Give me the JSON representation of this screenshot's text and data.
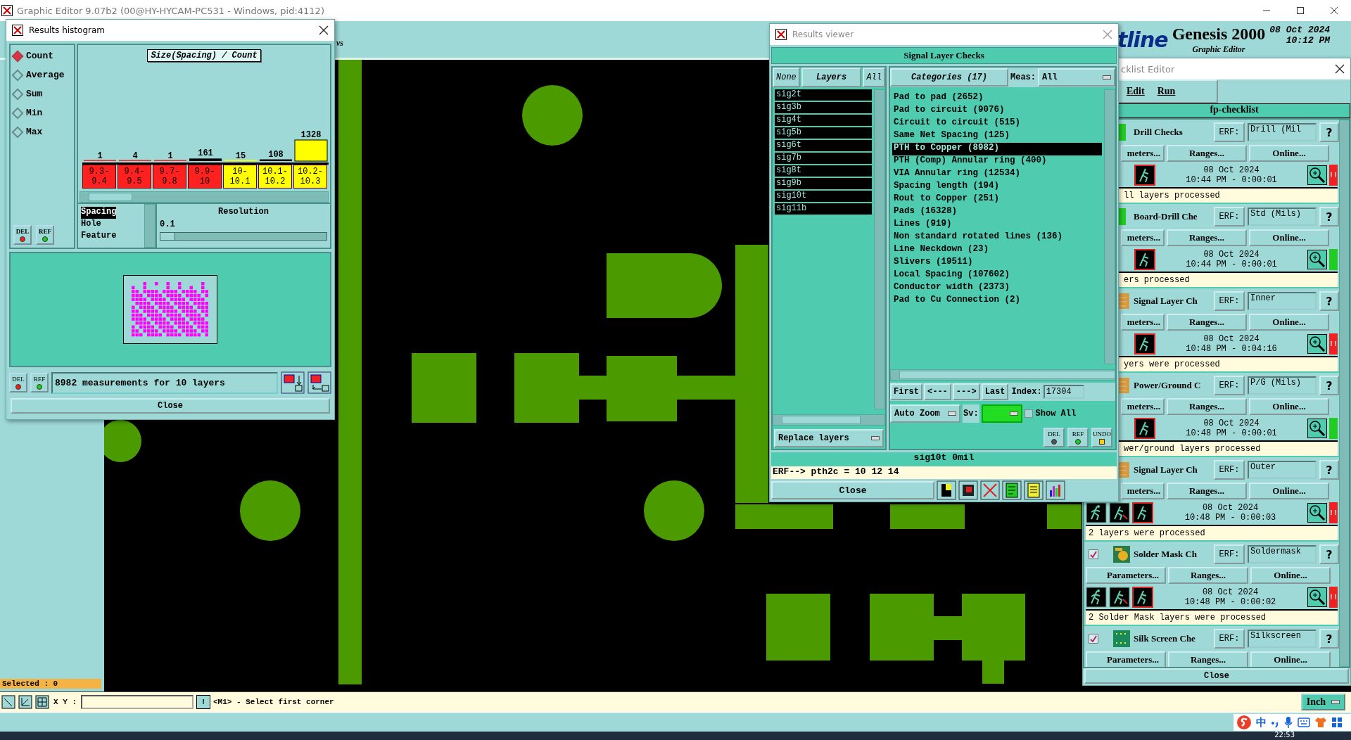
{
  "app": {
    "title": "Graphic Editor 9.07b2 (00@HY-HYCAM-PC531 - Windows, pid:4112)",
    "toolbar_fragment": "vs"
  },
  "banner": {
    "logo": "tline",
    "product": "Genesis 2000",
    "date": "08 Oct 2024",
    "time": "10:12 PM",
    "subtitle": "Graphic Editor"
  },
  "histogram": {
    "title": "Results histogram",
    "modes": [
      {
        "label": "Count",
        "selected": true
      },
      {
        "label": "Average",
        "selected": false
      },
      {
        "label": "Sum",
        "selected": false
      },
      {
        "label": "Min",
        "selected": false
      },
      {
        "label": "Max",
        "selected": false
      }
    ],
    "top_buttons": [
      "DEL",
      "REF"
    ],
    "chart_title": "Size(Spacing) / Count",
    "chart_data": {
      "type": "bar",
      "categories": [
        "9.3-9.4",
        "9.4-9.5",
        "9.7-9.8",
        "9.9-10",
        "10-10.1",
        "10.1-10.2",
        "10.2-10.3"
      ],
      "values": [
        1,
        4,
        1,
        161,
        15,
        108,
        1328
      ],
      "data_labels": true
    },
    "bins": [
      {
        "color": "#ff2020"
      },
      {
        "color": "#ff2020"
      },
      {
        "color": "#ff2020"
      },
      {
        "color": "#ff2020"
      },
      {
        "color": "#ffff00"
      },
      {
        "color": "#ffff00"
      },
      {
        "color": "#ffff00"
      }
    ],
    "measures": [
      {
        "label": "Spacing",
        "selected": true
      },
      {
        "label": "Hole",
        "selected": false
      },
      {
        "label": "Feature",
        "selected": false
      }
    ],
    "resolution_label": "Resolution",
    "resolution_value": "0.1",
    "resolution_slider": {
      "level": 0.08
    },
    "bottom_buttons": [
      "DEL",
      "REF"
    ],
    "summary": "8982 measurements for 10 layers",
    "close": "Close"
  },
  "viewer": {
    "title": "Results viewer",
    "header": "Signal Layer Checks",
    "layer_buttons": [
      "None",
      "Layers",
      "All"
    ],
    "layers": [
      {
        "name": "sig2t",
        "selected": true
      },
      {
        "name": "sig3b",
        "selected": true
      },
      {
        "name": "sig4t",
        "selected": true
      },
      {
        "name": "sig5b",
        "selected": true
      },
      {
        "name": "sig6t",
        "selected": true
      },
      {
        "name": "sig7b",
        "selected": true
      },
      {
        "name": "sig8t",
        "selected": true
      },
      {
        "name": "sig9b",
        "selected": true
      },
      {
        "name": "sig10t",
        "selected": true
      },
      {
        "name": "sig11b",
        "selected": true
      }
    ],
    "categories_button": "Categories (17)",
    "meas_label": "Meas:",
    "meas_value": "All",
    "categories": [
      {
        "label": "Pad to pad (2652)",
        "selected": false
      },
      {
        "label": "Pad to circuit (9076)",
        "selected": false
      },
      {
        "label": "Circuit to circuit (515)",
        "selected": false
      },
      {
        "label": "Same Net Spacing (125)",
        "selected": false
      },
      {
        "label": "PTH to Copper (8982)",
        "selected": true
      },
      {
        "label": "PTH (Comp) Annular ring (400)",
        "selected": false
      },
      {
        "label": "VIA Annular ring (12534)",
        "selected": false
      },
      {
        "label": "Spacing length (194)",
        "selected": false
      },
      {
        "label": "Rout to Copper (251)",
        "selected": false
      },
      {
        "label": "Pads (16328)",
        "selected": false
      },
      {
        "label": "Lines (919)",
        "selected": false
      },
      {
        "label": "Non standard rotated lines (136)",
        "selected": false
      },
      {
        "label": "Line Neckdown (23)",
        "selected": false
      },
      {
        "label": "Slivers (19511)",
        "selected": false
      },
      {
        "label": "Local Spacing (107602)",
        "selected": false
      },
      {
        "label": "Conductor width (2373)",
        "selected": false
      },
      {
        "label": "Pad to Cu Connection (2)",
        "selected": false
      }
    ],
    "nav": [
      "First",
      "<---",
      "--->",
      "Last"
    ],
    "index_label": "Index:",
    "index_value": "17304",
    "zoom_mode": "Auto Zoom",
    "sv_label": "Sv:",
    "show_all": {
      "label": "Show All",
      "checked": false
    },
    "replace_mode": "Replace layers",
    "action_buttons": [
      "DEL",
      "REF",
      "UNDO"
    ],
    "layer_info": "sig10t 0mil",
    "erf_line": "ERF--> pth2c = 10 12 14",
    "close": "Close"
  },
  "checklist": {
    "title": "cklist Editor",
    "menu": [
      "Edit",
      "Run"
    ],
    "name": "fp-checklist",
    "rows": [
      {
        "kind": "drill",
        "name": "Drill Checks",
        "erf_label": "ERF:",
        "erf": "Drill (Mil",
        "help": "?",
        "params": "meters...",
        "ranges": "Ranges...",
        "online": "Online...",
        "date": "08 Oct 2024",
        "time": "10:44 PM - 0:00:01",
        "failed": true,
        "flag": "!!",
        "status": "ll layers processed"
      },
      {
        "kind": "drill",
        "name": "Board-Drill Che",
        "erf_label": "ERF:",
        "erf": "Std (Mils)",
        "help": "?",
        "params": "meters...",
        "ranges": "Ranges...",
        "online": "Online...",
        "date": "08 Oct 2024",
        "time": "10:44 PM - 0:00:01",
        "failed": false,
        "status": "ers processed"
      },
      {
        "kind": "layer",
        "name": "Signal Layer Ch",
        "erf_label": "ERF:",
        "erf": "Inner",
        "help": "?",
        "params": "meters...",
        "ranges": "Ranges...",
        "online": "Online...",
        "date": "08 Oct 2024",
        "time": "10:48 PM - 0:04:16",
        "failed": true,
        "flag": "!!",
        "status": "yers were processed"
      },
      {
        "kind": "layer",
        "name": "Power/Ground C",
        "erf_label": "ERF:",
        "erf": "P/G (Mils)",
        "help": "?",
        "params": "meters...",
        "ranges": "Ranges...",
        "online": "Online...",
        "date": "08 Oct 2024",
        "time": "10:48 PM - 0:00:01",
        "failed": false,
        "status": "wer/ground layers processed"
      },
      {
        "kind": "layer",
        "name": "Signal Layer Ch",
        "erf_label": "ERF:",
        "erf": "Outer",
        "help": "?",
        "params": "meters...",
        "ranges": "Ranges...",
        "online": "Online...",
        "date": "08 Oct 2024",
        "time": "10:48 PM - 0:00:03",
        "failed": true,
        "flag": "!!",
        "status": "2 layers were processed"
      },
      {
        "kind": "mask",
        "checked": true,
        "name": "Solder Mask Ch",
        "erf_label": "ERF:",
        "erf": "Soldermask",
        "help": "?",
        "params": "Parameters...",
        "ranges": "Ranges...",
        "online": "Online...",
        "date": "08 Oct 2024",
        "time": "10:48 PM - 0:00:02",
        "failed": true,
        "flag": "!!",
        "status": "2 Solder Mask layers were processed"
      },
      {
        "kind": "silk",
        "checked": true,
        "name": "Silk Screen Che",
        "erf_label": "ERF:",
        "erf": "Silkscreen",
        "help": "?",
        "params": "Parameters...",
        "ranges": "Ranges...",
        "online": "Online..."
      }
    ],
    "close": "Close"
  },
  "status_bar": {
    "selected": "Selected : 0",
    "xy_label": "X Y :",
    "bang": "!",
    "prompt": "<M1> - Select first corner",
    "units": "Inch"
  },
  "taskbar": {
    "ime": "中",
    "clock": "22:53"
  }
}
